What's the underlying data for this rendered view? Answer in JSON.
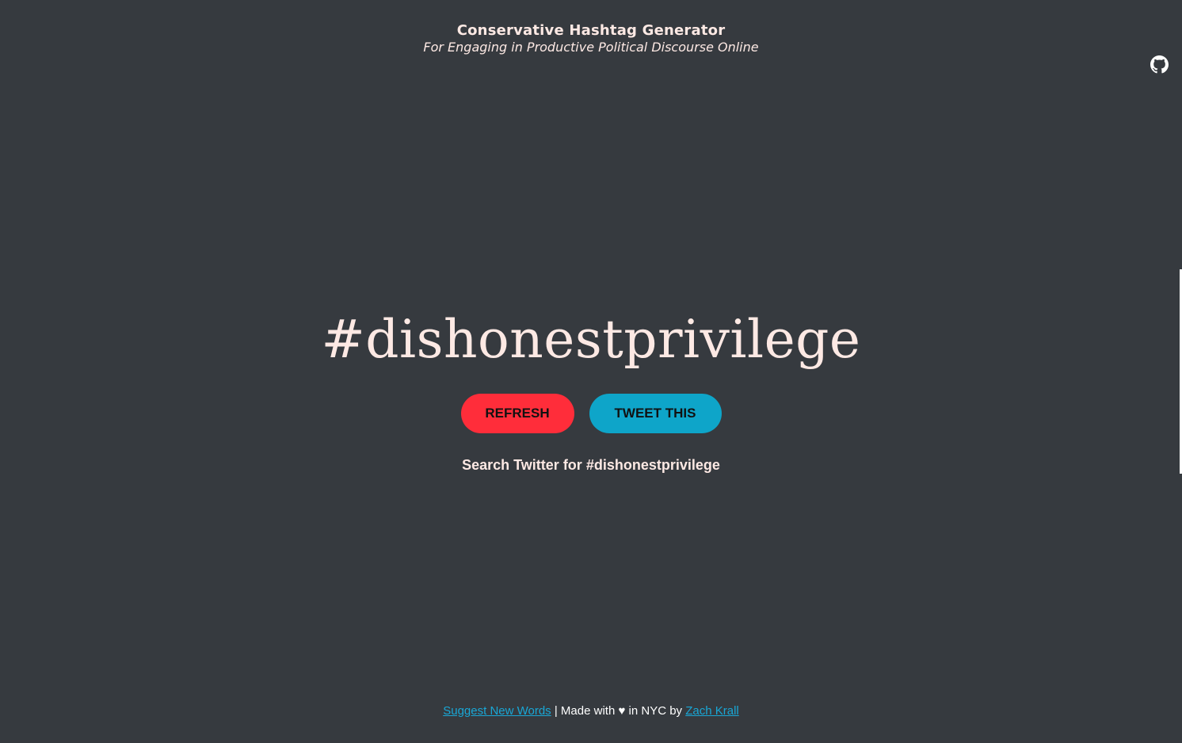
{
  "header": {
    "title": "Conservative Hashtag Generator",
    "subtitle": "For Engaging in Productive Political Discourse Online"
  },
  "github": {
    "icon": "github-icon"
  },
  "hashtag": "#dishonestprivilege",
  "buttons": {
    "refresh_label": "REFRESH",
    "tweet_label": "TWEET THIS"
  },
  "search": {
    "prefix": "Search Twitter for ",
    "hashtag": "#dishonestprivilege"
  },
  "footer": {
    "suggest_label": "Suggest New Words",
    "separator": " | Made with ",
    "heart": "♥",
    "mid": " in NYC by ",
    "author_label": "Zach Krall"
  },
  "colors": {
    "background": "#363a3f",
    "text": "#fde9e4",
    "refresh_button": "#ff2d3a",
    "tweet_button": "#0ea5c9",
    "link": "#19a7d6"
  }
}
